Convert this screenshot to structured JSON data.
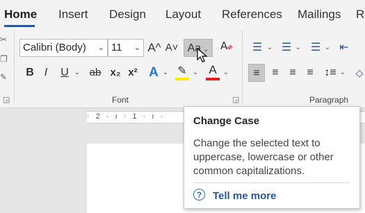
{
  "tabs": [
    {
      "label": "Home",
      "active": true
    },
    {
      "label": "Insert"
    },
    {
      "label": "Design"
    },
    {
      "label": "Layout"
    },
    {
      "label": "References"
    },
    {
      "label": "Mailings"
    },
    {
      "label": "R"
    }
  ],
  "font_group": {
    "font_name": "Calibri (Body)",
    "font_size": "11",
    "grow_label": "A^",
    "shrink_label": "A˅",
    "change_case_label": "Aa",
    "bold": "B",
    "italic": "I",
    "underline": "U",
    "strikethrough": "ab",
    "subscript": "x₂",
    "superscript": "x²",
    "text_effects": "A",
    "font_color": "A",
    "group_label": "Font",
    "highlight_color": "#ffeb00",
    "font_color_value": "#e02020"
  },
  "paragraph_group": {
    "group_label": "Paragraph"
  },
  "ruler": {
    "marks": "· 2 · ı · 1 · ı ·"
  },
  "tooltip": {
    "title": "Change Case",
    "description": "Change the selected text to uppercase, lowercase or other common capitalizations.",
    "link_label": "Tell me more",
    "help_icon": "?"
  },
  "colors": {
    "accent": "#2b579a",
    "ribbon_bg": "#f3f3f3"
  }
}
